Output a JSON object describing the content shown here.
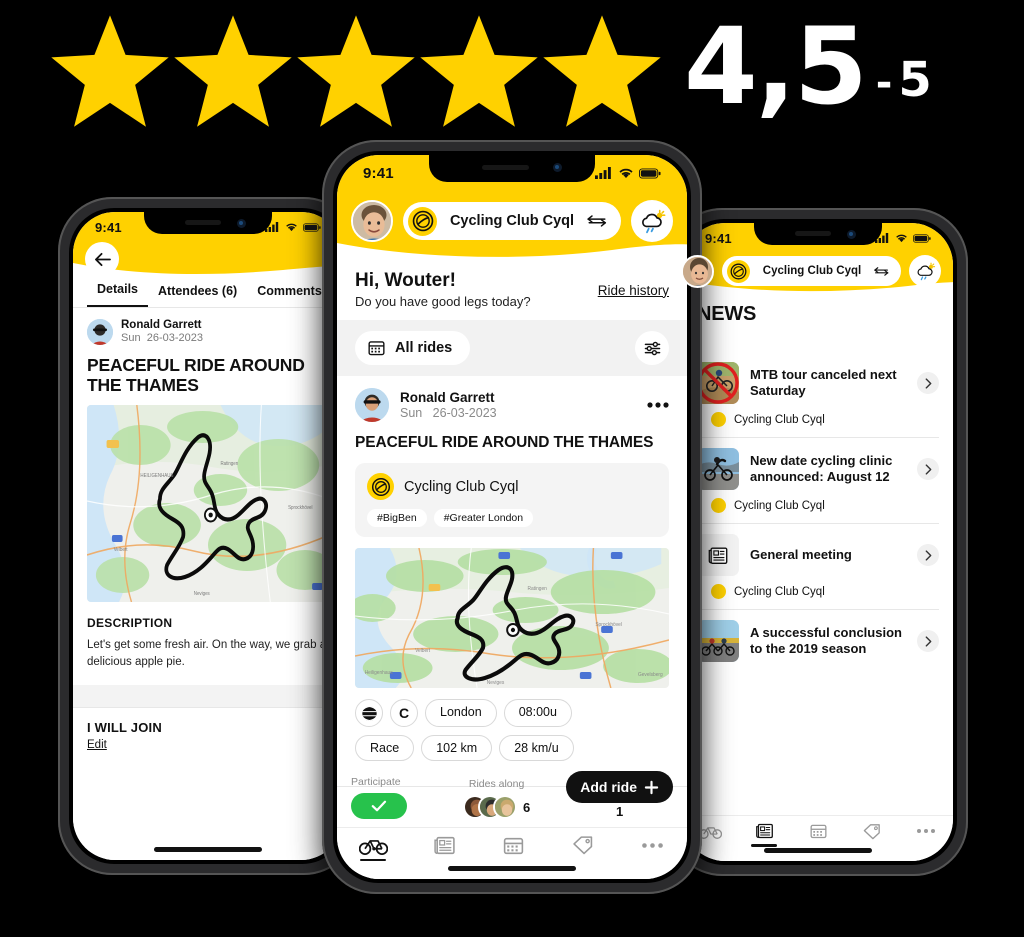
{
  "rating": {
    "stars_filled": 5,
    "star_color": "#FFD100",
    "score": "4,5",
    "dash": "-",
    "max": "5"
  },
  "phone_left": {
    "status": {
      "time": "9:41"
    },
    "header": {
      "back_icon": "arrow-left-icon"
    },
    "tabs": [
      {
        "label": "Details",
        "active": true
      },
      {
        "label": "Attendees (6)",
        "active": false
      },
      {
        "label": "Comments",
        "active": false
      }
    ],
    "author": {
      "name": "Ronald Garrett",
      "day": "Sun",
      "date": "26-03-2023"
    },
    "ride_title": "PEACEFUL RIDE AROUND THE THAMES",
    "description": {
      "heading": "DESCRIPTION",
      "body": "Let's get some fresh air. On the way, we grab a delicious apple pie."
    },
    "join": {
      "title": "I WILL JOIN",
      "edit": "Edit"
    }
  },
  "phone_center": {
    "status": {
      "time": "9:41"
    },
    "header": {
      "club_name": "Cycling Club Cyql",
      "swap_icon": "swap-arrows-icon",
      "weather_icon": "cloud-sun-rain-icon"
    },
    "greeting": {
      "name": "Hi, Wouter!",
      "subtitle": "Do you have good legs today?",
      "ride_history": "Ride history"
    },
    "filters": {
      "all_rides": "All rides",
      "calendar_icon": "calendar-icon",
      "settings_icon": "sliders-icon"
    },
    "post": {
      "author": {
        "name": "Ronald Garrett",
        "day": "Sun",
        "date": "26-03-2023"
      },
      "more_icon": "more-horizontal-icon",
      "title": "PEACEFUL RIDE AROUND THE THAMES",
      "club": "Cycling Club Cyql",
      "tags": [
        "#BigBen",
        "#Greater London"
      ],
      "chips": [
        {
          "type": "icon",
          "label": "globe-icon"
        },
        {
          "type": "icon",
          "label": "C"
        },
        {
          "type": "text",
          "label": "London"
        },
        {
          "type": "text",
          "label": "08:00u"
        }
      ],
      "chips2": [
        {
          "type": "text",
          "label": "Race"
        },
        {
          "type": "text",
          "label": "102 km"
        },
        {
          "type": "text",
          "label": "28 km/u"
        }
      ]
    },
    "action_bar": {
      "participate_label": "Participate",
      "check_icon": "check-icon",
      "rides_along_label": "Rides along",
      "rides_along_count": "6",
      "add_ride_label": "Add ride",
      "add_ride_plus": "+",
      "add_ride_count": "1"
    },
    "tabbar": [
      {
        "icon": "bicycle-icon",
        "active": true
      },
      {
        "icon": "newspaper-icon",
        "active": false
      },
      {
        "icon": "calendar-icon",
        "active": false
      },
      {
        "icon": "tag-icon",
        "active": false
      },
      {
        "icon": "more-icon",
        "active": false
      }
    ]
  },
  "phone_right": {
    "status": {
      "time": "9:41"
    },
    "header": {
      "club_name": "Cycling Club Cyql",
      "swap_icon": "swap-arrows-icon",
      "weather_icon": "cloud-sun-rain-icon"
    },
    "page_title": "NEWS",
    "news": [
      {
        "title": "MTB tour canceled next Saturday",
        "club": "Cycling Club Cyql",
        "thumb": "mtb-canceled",
        "chevron": "chevron-right-icon"
      },
      {
        "title": "New date cycling clinic announced: August 12",
        "club": "Cycling Club Cyql",
        "thumb": "cycling-clinic",
        "chevron": "chevron-right-icon"
      },
      {
        "title": "General meeting",
        "club": "Cycling Club Cyql",
        "thumb": "document-icon",
        "chevron": "chevron-right-icon"
      },
      {
        "title": "A successful conclusion to the 2019 season",
        "club": "Cycling Club Cyql",
        "thumb": "peloton",
        "chevron": "chevron-right-icon"
      }
    ],
    "tabbar": [
      {
        "icon": "bicycle-icon",
        "active": false
      },
      {
        "icon": "newspaper-icon",
        "active": true
      },
      {
        "icon": "calendar-icon",
        "active": false
      },
      {
        "icon": "tag-icon",
        "active": false
      },
      {
        "icon": "more-icon",
        "active": false
      }
    ]
  }
}
